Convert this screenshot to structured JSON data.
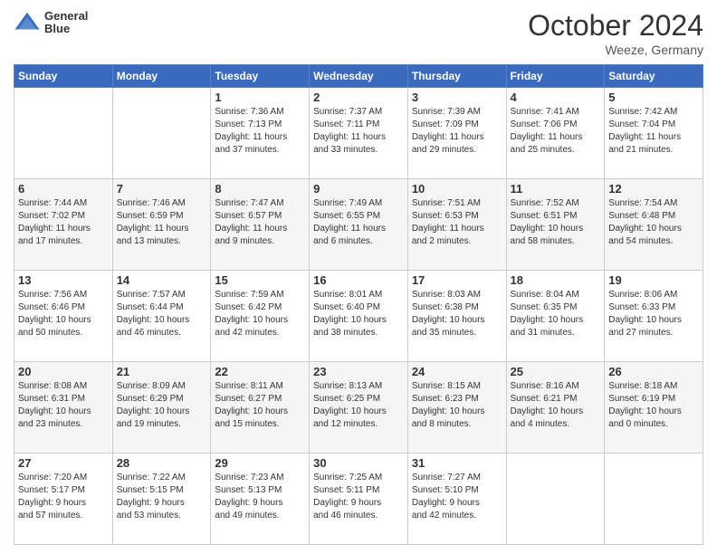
{
  "header": {
    "logo_line1": "General",
    "logo_line2": "Blue",
    "month_title": "October 2024",
    "location": "Weeze, Germany"
  },
  "weekdays": [
    "Sunday",
    "Monday",
    "Tuesday",
    "Wednesday",
    "Thursday",
    "Friday",
    "Saturday"
  ],
  "weeks": [
    [
      {
        "day": "",
        "info": ""
      },
      {
        "day": "",
        "info": ""
      },
      {
        "day": "1",
        "info": "Sunrise: 7:36 AM\nSunset: 7:13 PM\nDaylight: 11 hours\nand 37 minutes."
      },
      {
        "day": "2",
        "info": "Sunrise: 7:37 AM\nSunset: 7:11 PM\nDaylight: 11 hours\nand 33 minutes."
      },
      {
        "day": "3",
        "info": "Sunrise: 7:39 AM\nSunset: 7:09 PM\nDaylight: 11 hours\nand 29 minutes."
      },
      {
        "day": "4",
        "info": "Sunrise: 7:41 AM\nSunset: 7:06 PM\nDaylight: 11 hours\nand 25 minutes."
      },
      {
        "day": "5",
        "info": "Sunrise: 7:42 AM\nSunset: 7:04 PM\nDaylight: 11 hours\nand 21 minutes."
      }
    ],
    [
      {
        "day": "6",
        "info": "Sunrise: 7:44 AM\nSunset: 7:02 PM\nDaylight: 11 hours\nand 17 minutes."
      },
      {
        "day": "7",
        "info": "Sunrise: 7:46 AM\nSunset: 6:59 PM\nDaylight: 11 hours\nand 13 minutes."
      },
      {
        "day": "8",
        "info": "Sunrise: 7:47 AM\nSunset: 6:57 PM\nDaylight: 11 hours\nand 9 minutes."
      },
      {
        "day": "9",
        "info": "Sunrise: 7:49 AM\nSunset: 6:55 PM\nDaylight: 11 hours\nand 6 minutes."
      },
      {
        "day": "10",
        "info": "Sunrise: 7:51 AM\nSunset: 6:53 PM\nDaylight: 11 hours\nand 2 minutes."
      },
      {
        "day": "11",
        "info": "Sunrise: 7:52 AM\nSunset: 6:51 PM\nDaylight: 10 hours\nand 58 minutes."
      },
      {
        "day": "12",
        "info": "Sunrise: 7:54 AM\nSunset: 6:48 PM\nDaylight: 10 hours\nand 54 minutes."
      }
    ],
    [
      {
        "day": "13",
        "info": "Sunrise: 7:56 AM\nSunset: 6:46 PM\nDaylight: 10 hours\nand 50 minutes."
      },
      {
        "day": "14",
        "info": "Sunrise: 7:57 AM\nSunset: 6:44 PM\nDaylight: 10 hours\nand 46 minutes."
      },
      {
        "day": "15",
        "info": "Sunrise: 7:59 AM\nSunset: 6:42 PM\nDaylight: 10 hours\nand 42 minutes."
      },
      {
        "day": "16",
        "info": "Sunrise: 8:01 AM\nSunset: 6:40 PM\nDaylight: 10 hours\nand 38 minutes."
      },
      {
        "day": "17",
        "info": "Sunrise: 8:03 AM\nSunset: 6:38 PM\nDaylight: 10 hours\nand 35 minutes."
      },
      {
        "day": "18",
        "info": "Sunrise: 8:04 AM\nSunset: 6:35 PM\nDaylight: 10 hours\nand 31 minutes."
      },
      {
        "day": "19",
        "info": "Sunrise: 8:06 AM\nSunset: 6:33 PM\nDaylight: 10 hours\nand 27 minutes."
      }
    ],
    [
      {
        "day": "20",
        "info": "Sunrise: 8:08 AM\nSunset: 6:31 PM\nDaylight: 10 hours\nand 23 minutes."
      },
      {
        "day": "21",
        "info": "Sunrise: 8:09 AM\nSunset: 6:29 PM\nDaylight: 10 hours\nand 19 minutes."
      },
      {
        "day": "22",
        "info": "Sunrise: 8:11 AM\nSunset: 6:27 PM\nDaylight: 10 hours\nand 15 minutes."
      },
      {
        "day": "23",
        "info": "Sunrise: 8:13 AM\nSunset: 6:25 PM\nDaylight: 10 hours\nand 12 minutes."
      },
      {
        "day": "24",
        "info": "Sunrise: 8:15 AM\nSunset: 6:23 PM\nDaylight: 10 hours\nand 8 minutes."
      },
      {
        "day": "25",
        "info": "Sunrise: 8:16 AM\nSunset: 6:21 PM\nDaylight: 10 hours\nand 4 minutes."
      },
      {
        "day": "26",
        "info": "Sunrise: 8:18 AM\nSunset: 6:19 PM\nDaylight: 10 hours\nand 0 minutes."
      }
    ],
    [
      {
        "day": "27",
        "info": "Sunrise: 7:20 AM\nSunset: 5:17 PM\nDaylight: 9 hours\nand 57 minutes."
      },
      {
        "day": "28",
        "info": "Sunrise: 7:22 AM\nSunset: 5:15 PM\nDaylight: 9 hours\nand 53 minutes."
      },
      {
        "day": "29",
        "info": "Sunrise: 7:23 AM\nSunset: 5:13 PM\nDaylight: 9 hours\nand 49 minutes."
      },
      {
        "day": "30",
        "info": "Sunrise: 7:25 AM\nSunset: 5:11 PM\nDaylight: 9 hours\nand 46 minutes."
      },
      {
        "day": "31",
        "info": "Sunrise: 7:27 AM\nSunset: 5:10 PM\nDaylight: 9 hours\nand 42 minutes."
      },
      {
        "day": "",
        "info": ""
      },
      {
        "day": "",
        "info": ""
      }
    ]
  ]
}
